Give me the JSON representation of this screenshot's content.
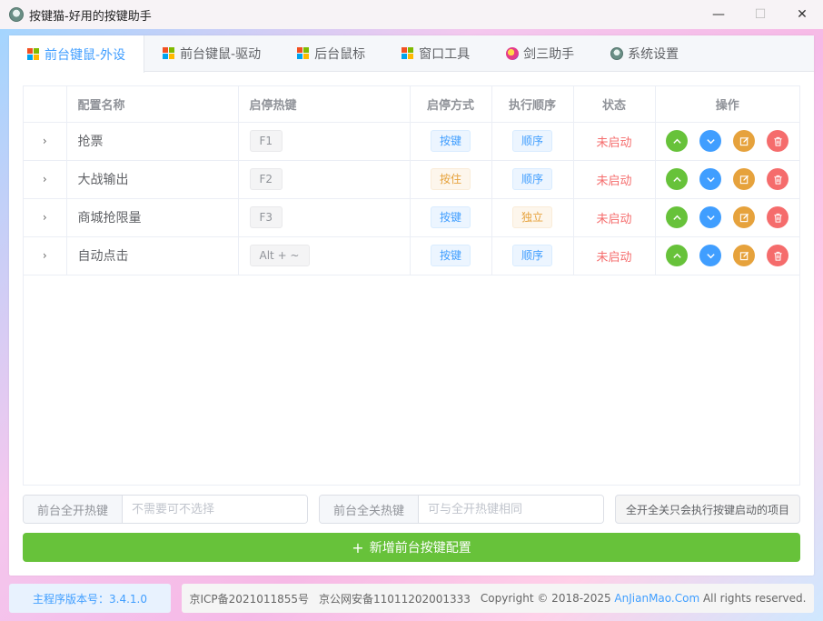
{
  "window": {
    "title": "按键猫-好用的按键助手",
    "minimize_glyph": "—",
    "maximize_glyph": "☐",
    "close_glyph": "✕"
  },
  "tabs": [
    {
      "label": "前台键鼠-外设",
      "icon": "windows-icon",
      "active": true
    },
    {
      "label": "前台键鼠-驱动",
      "icon": "windows-icon",
      "active": false
    },
    {
      "label": "后台鼠标",
      "icon": "windows-icon",
      "active": false
    },
    {
      "label": "窗口工具",
      "icon": "windows-icon",
      "active": false
    },
    {
      "label": "剑三助手",
      "icon": "sword-icon",
      "active": false
    },
    {
      "label": "系统设置",
      "icon": "cat-icon",
      "active": false
    }
  ],
  "table": {
    "headers": {
      "name": "配置名称",
      "hotkey": "启停热键",
      "mode": "启停方式",
      "order": "执行顺序",
      "status": "状态",
      "actions": "操作"
    },
    "rows": [
      {
        "name": "抢票",
        "hotkey": "F1",
        "mode": "按键",
        "mode_color": "blue",
        "order": "顺序",
        "order_color": "blue",
        "status": "未启动"
      },
      {
        "name": "大战输出",
        "hotkey": "F2",
        "mode": "按住",
        "mode_color": "orange",
        "order": "顺序",
        "order_color": "blue",
        "status": "未启动"
      },
      {
        "name": "商城抢限量",
        "hotkey": "F3",
        "mode": "按键",
        "mode_color": "blue",
        "order": "独立",
        "order_color": "orange",
        "status": "未启动"
      },
      {
        "name": "自动点击",
        "hotkey": "Alt + ~",
        "mode": "按键",
        "mode_color": "blue",
        "order": "顺序",
        "order_color": "blue",
        "status": "未启动"
      }
    ]
  },
  "hotkeys": {
    "all_on_label": "前台全开热键",
    "all_on_placeholder": "不需要可不选择",
    "all_off_label": "前台全关热键",
    "all_off_placeholder": "可与全开热键相同",
    "note": "全开全关只会执行按键启动的项目"
  },
  "add_button": "新增前台按键配置",
  "footer": {
    "version": "主程序版本号：3.4.1.0",
    "icp": "京ICP备2021011855号",
    "police": "京公网安备11011202001333",
    "copyright_prefix": "Copyright © 2018-2025",
    "brand": "AnJianMao.Com",
    "copyright_suffix": "All rights reserved."
  },
  "colors": {
    "primary": "#409eff",
    "success": "#67c23a",
    "warning": "#e6a23c",
    "danger": "#f56c6c"
  }
}
